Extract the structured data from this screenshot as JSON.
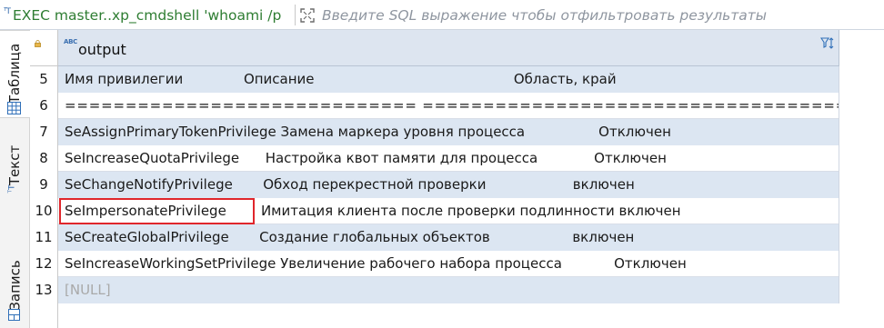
{
  "query_tab": {
    "icon": "text-type-icon",
    "text": "EXEC master..xp_cmdshell 'whoami /p"
  },
  "filter": {
    "placeholder": "Введите SQL выражение чтобы отфильтровать результаты",
    "icon": "expand-icon"
  },
  "side_tabs": [
    {
      "label": "Таблица",
      "icon": "grid-icon",
      "active": true
    },
    {
      "label": "Текст",
      "icon": "text-type-icon",
      "active": false
    },
    {
      "label": "Запись",
      "icon": "record-icon",
      "active": false
    }
  ],
  "column": {
    "name": "output",
    "type_badge": "ABC",
    "sort_icon": "filter-sort-icon"
  },
  "rows": [
    {
      "num": "5",
      "text": "Имя привилегии              Описание                                              Область, край"
    },
    {
      "num": "6",
      "text": "============================= ================================================ =============="
    },
    {
      "num": "7",
      "text": "SeAssignPrimaryTokenPrivilege Замена маркера уровня процесса                 Отключен"
    },
    {
      "num": "8",
      "text": "SeIncreaseQuotaPrivilege      Настройка квот памяти для процесса             Отключен"
    },
    {
      "num": "9",
      "text": "SeChangeNotifyPrivilege       Обход перекрестной проверки                    включен"
    },
    {
      "num": "10",
      "text": "SeImpersonatePrivilege        Имитация клиента после проверки подлинности включен"
    },
    {
      "num": "11",
      "text": "SeCreateGlobalPrivilege       Создание глобальных объектов                   включен"
    },
    {
      "num": "12",
      "text": "SeIncreaseWorkingSetPrivilege Увеличение рабочего набора процесса            Отключен"
    },
    {
      "num": "13",
      "text": "[NULL]"
    }
  ],
  "colors": {
    "header": "#dde5f0",
    "row_tint": "#dce6f2",
    "query_green": "#2e7d32",
    "highlight": "#e0262b"
  }
}
